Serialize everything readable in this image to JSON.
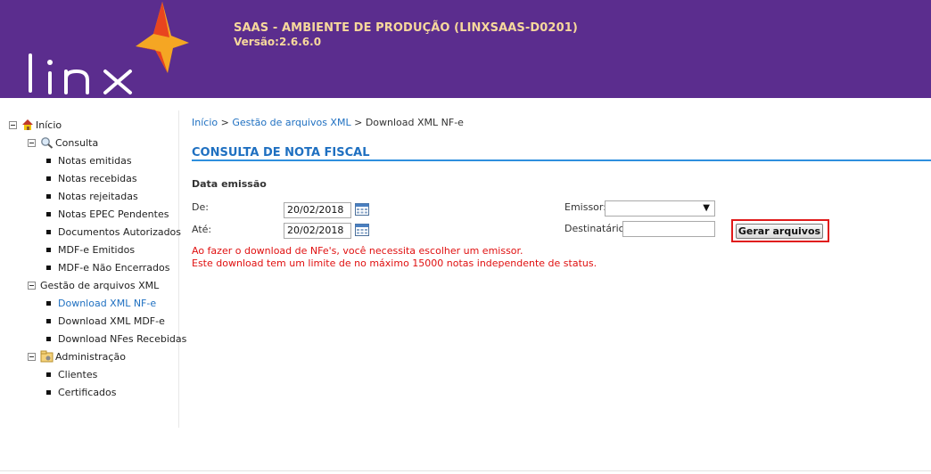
{
  "header": {
    "logo_text": "linx",
    "env_title": "SAAS - AMBIENTE DE PRODUÇÃO (LINXSAAS-D0201)",
    "version": "Versão:2.6.6.0",
    "brand_color": "#5b2d8e",
    "accent_color": "#f5a623"
  },
  "sidebar": {
    "root": {
      "label": "Início",
      "icon": "home-icon"
    },
    "consulta": {
      "label": "Consulta",
      "icon": "magnifier-icon",
      "items": [
        "Notas emitidas",
        "Notas recebidas",
        "Notas rejeitadas",
        "Notas EPEC Pendentes",
        "Documentos Autorizados",
        "MDF-e Emitidos",
        "MDF-e Não Encerrados"
      ]
    },
    "gestao": {
      "label": "Gestão de arquivos XML",
      "items": [
        "Download XML NF-e",
        "Download XML MDF-e",
        "Download NFes Recebidas"
      ],
      "active_item": "Download XML NF-e"
    },
    "admin": {
      "label": "Administração",
      "icon": "folder-gear-icon",
      "items": [
        "Clientes",
        "Certificados"
      ]
    }
  },
  "breadcrumb": {
    "home": "Início",
    "sep1": ">",
    "section": "Gestão de arquivos XML",
    "sep2": ">",
    "current": "Download XML NF-e"
  },
  "main": {
    "title": "CONSULTA DE NOTA FISCAL",
    "section_label": "Data emissão",
    "de_label": "De:",
    "de_value": "20/02/2018",
    "ate_label": "Até:",
    "ate_value": "20/02/2018",
    "emissor_label": "Emissor:",
    "emissor_value": "",
    "destinatario_label": "Destinatário:",
    "destinatario_value": "",
    "button_label": "Gerar arquivos",
    "msg1": "Ao fazer o download de NFe's, você necessita escolher um emissor.",
    "msg2": "Este download tem um limite de no máximo 15000 notas independente de status."
  }
}
